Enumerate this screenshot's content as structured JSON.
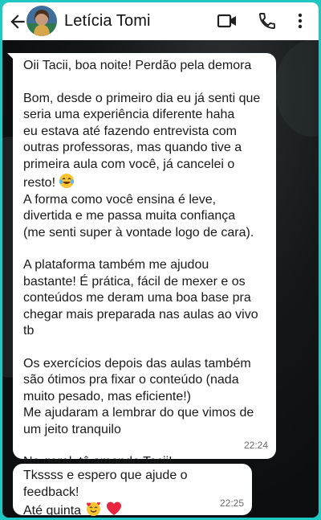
{
  "header": {
    "contact_name": "Letícia Tomi",
    "icons": [
      "back-arrow-icon",
      "video-call-icon",
      "phone-icon",
      "more-vert-icon"
    ]
  },
  "messages": [
    {
      "paragraphs": [
        [
          "Oii Tacii, boa noite! Perdão pela demora"
        ],
        [
          "Bom, desde o primeiro dia eu já senti que",
          "seria uma experiência diferente haha",
          "eu estava até fazendo entrevista com",
          "outras professoras, mas quando tive a",
          "primeira aula com você, já cancelei o",
          "resto!"
        ],
        [
          "A forma como você ensina é leve,",
          "divertida e me passa muita confiança",
          "(me senti super à vontade logo de cara)."
        ],
        [
          "A plataforma também me ajudou",
          "bastante! É prática, fácil de mexer e os",
          "conteúdos me deram uma boa base pra",
          "chegar mais preparada nas aulas ao vivo",
          "tb"
        ],
        [
          "Os exercícios depois das aulas também",
          "são ótimos pra fixar o conteúdo (nada",
          "muito pesado, mas eficiente!)",
          "Me ajudaram a lembrar do que vimos de",
          "um jeito tranquilo"
        ],
        [
          "No geral, tô amando Tacii!"
        ]
      ],
      "time": "22:24"
    },
    {
      "lines": [
        "Tkssss e espero que ajude o feedback!",
        "Até quinta"
      ],
      "time": "22:25"
    }
  ],
  "colors": {
    "frame_border": "#1fc8c3",
    "bubble": "#ffffff",
    "header": "#ffffff",
    "chat_background": "#0c0e0f"
  }
}
